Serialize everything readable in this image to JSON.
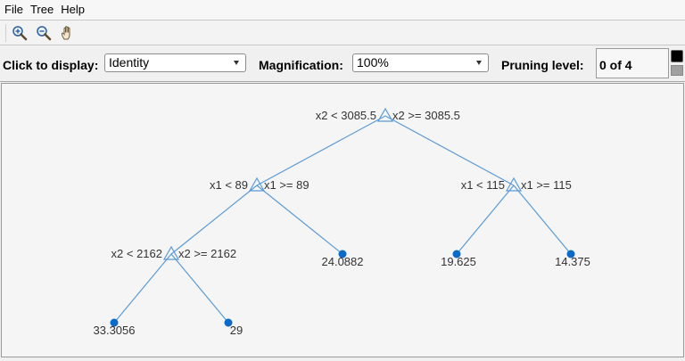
{
  "menubar": {
    "items": [
      "File",
      "Tree",
      "Help"
    ]
  },
  "toolbar": {
    "icons": [
      "zoom-in-icon",
      "zoom-out-icon",
      "pan-hand-icon"
    ]
  },
  "controls": {
    "display_label": "Click to display:",
    "display_value": "Identity",
    "magnification_label": "Magnification:",
    "magnification_value": "100%",
    "pruning_label": "Pruning level:",
    "pruning_value": "0 of 4"
  },
  "colors": {
    "branch": "#5b9bd5",
    "leaf": "#0b6bc8",
    "text": "#333333"
  },
  "tree": {
    "root_left": "x2 < 3085.5",
    "root_right": "x2 >= 3085.5",
    "n2_left": "x1 < 89",
    "n2_right": "x1 >= 89",
    "n3_left": "x1 < 115",
    "n3_right": "x1 >= 115",
    "n4_left": "x2 < 2162",
    "n4_right": "x2 >= 2162",
    "leaf_a": "24.0882",
    "leaf_b": "19.625",
    "leaf_c": "14.375",
    "leaf_d": "33.3056",
    "leaf_e": "29"
  }
}
